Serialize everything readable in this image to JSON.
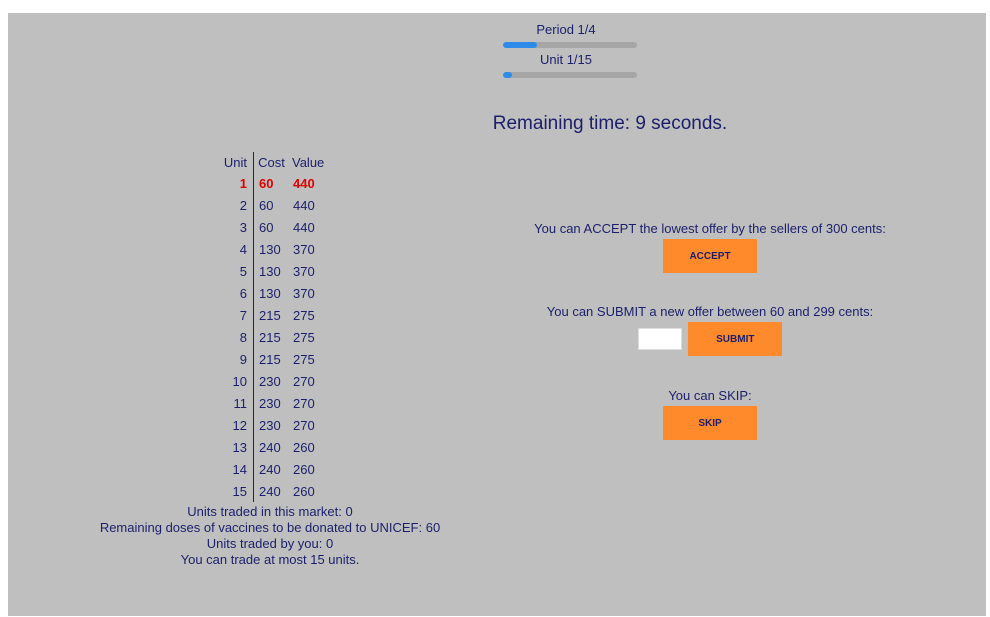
{
  "progress": {
    "period_label": "Period 1/4",
    "period_fraction": 0.25,
    "unit_label": "Unit 1/15",
    "unit_fraction": 0.0667
  },
  "timer_text": "Remaining time: 9 seconds.",
  "table": {
    "headers": [
      "Unit",
      "Cost",
      "Value"
    ],
    "rows": [
      [
        "1",
        "60",
        "440"
      ],
      [
        "2",
        "60",
        "440"
      ],
      [
        "3",
        "60",
        "440"
      ],
      [
        "4",
        "130",
        "370"
      ],
      [
        "5",
        "130",
        "370"
      ],
      [
        "6",
        "130",
        "370"
      ],
      [
        "7",
        "215",
        "275"
      ],
      [
        "8",
        "215",
        "275"
      ],
      [
        "9",
        "215",
        "275"
      ],
      [
        "10",
        "230",
        "270"
      ],
      [
        "11",
        "230",
        "270"
      ],
      [
        "12",
        "230",
        "270"
      ],
      [
        "13",
        "240",
        "260"
      ],
      [
        "14",
        "240",
        "260"
      ],
      [
        "15",
        "240",
        "260"
      ]
    ],
    "highlight_color": "#e00000"
  },
  "stats": {
    "units_traded_market": "Units traded in this market: 0",
    "remaining_doses": "Remaining doses of vaccines to be donated to UNICEF: 60",
    "units_traded_you": "Units traded by you: 0",
    "max_units": "You can trade at most 15 units."
  },
  "accept": {
    "text": "You can ACCEPT the lowest offer by the sellers of 300 cents:",
    "button_label": "ACCEPT"
  },
  "submit": {
    "text": "You can SUBMIT a new offer between 60 and 299 cents:",
    "input_value": "",
    "button_label": "SUBMIT"
  },
  "skip": {
    "text": "You can SKIP:",
    "button_label": "SKIP"
  },
  "colors": {
    "panel_bg": "#bfbfbf",
    "button_bg": "#ff8a2b",
    "text": "#1b1f6b",
    "progress_fill": "#2e8bea"
  }
}
